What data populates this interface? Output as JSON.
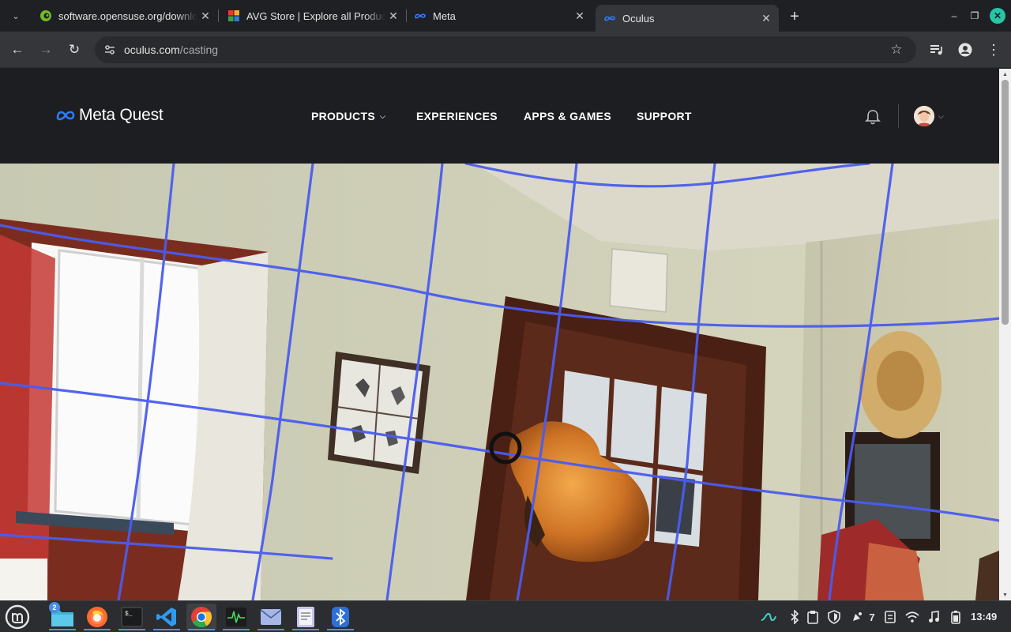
{
  "browser": {
    "tabs": [
      {
        "title": "software.opensuse.org/download",
        "icon": "opensuse-favicon",
        "active": false
      },
      {
        "title": "AVG Store | Explore all Products",
        "icon": "avg-favicon",
        "active": false
      },
      {
        "title": "Meta",
        "icon": "meta-favicon",
        "active": false
      },
      {
        "title": "Oculus",
        "icon": "meta-favicon",
        "active": true
      }
    ],
    "address": {
      "domain": "oculus.com",
      "path": "/casting"
    }
  },
  "site": {
    "logo_text": "Meta Quest",
    "nav": [
      {
        "label": "PRODUCTS",
        "has_dropdown": true
      },
      {
        "label": "EXPERIENCES",
        "has_dropdown": false
      },
      {
        "label": "APPS & GAMES",
        "has_dropdown": false
      },
      {
        "label": "SUPPORT",
        "has_dropdown": false
      }
    ]
  },
  "taskbar": {
    "apps": [
      {
        "name": "files",
        "icon": "folder-icon"
      },
      {
        "name": "firefox",
        "icon": "firefox-icon"
      },
      {
        "name": "terminal",
        "icon": "terminal-icon"
      },
      {
        "name": "vscode",
        "icon": "vscode-icon"
      },
      {
        "name": "chrome",
        "icon": "chrome-icon"
      },
      {
        "name": "system-monitor",
        "icon": "system-monitor-icon"
      },
      {
        "name": "mail",
        "icon": "mail-icon"
      },
      {
        "name": "text-editor",
        "icon": "text-editor-icon"
      },
      {
        "name": "bluetooth-manager",
        "icon": "bluetooth-icon"
      }
    ],
    "files_badge": "2",
    "notification_count": "7",
    "clock": "13:49"
  },
  "colors": {
    "grid_line": "#4a5cf0",
    "header_bg": "#1c1e21",
    "tab_active": "#35363a",
    "win_close": "#26c6a6"
  }
}
